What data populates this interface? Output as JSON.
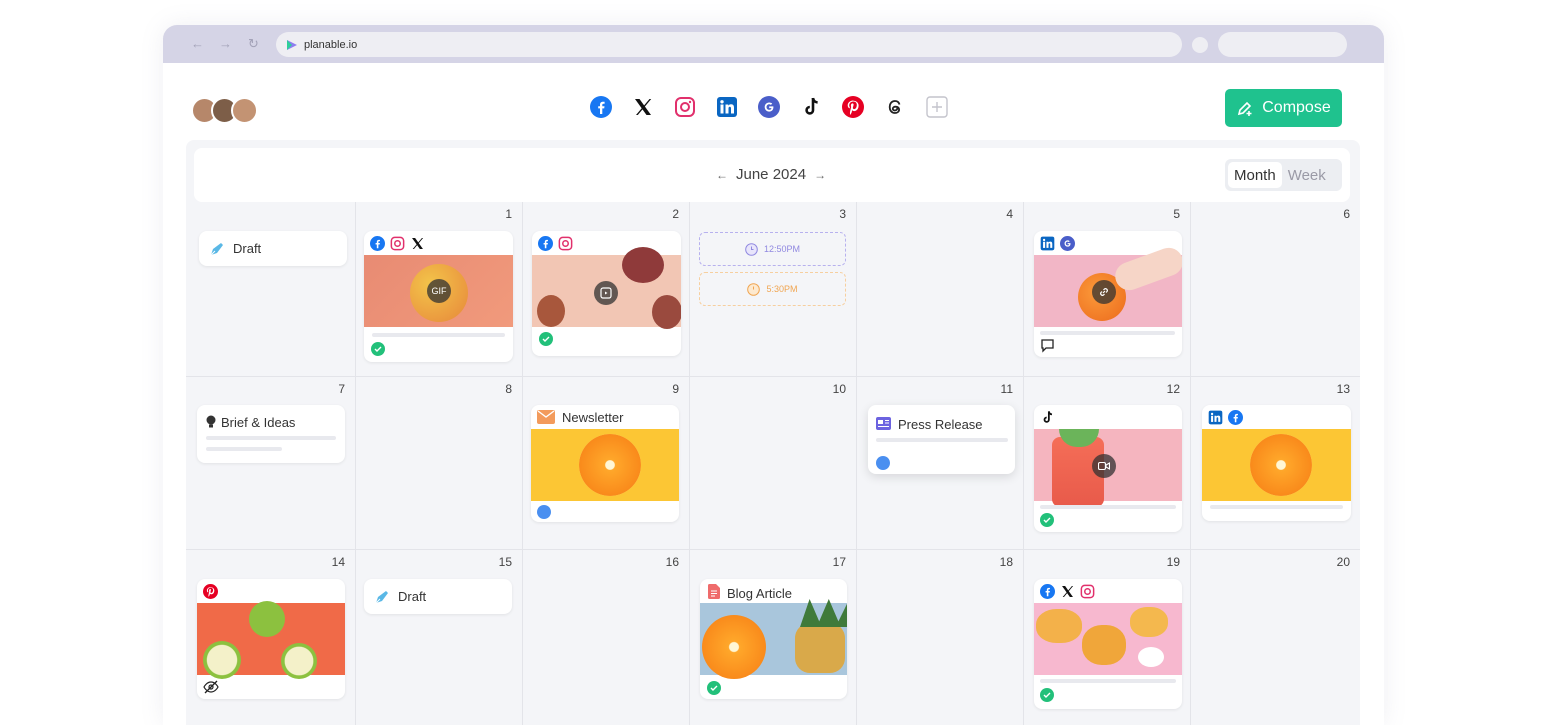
{
  "browser": {
    "url": "planable.io"
  },
  "header": {
    "compose_label": "Compose",
    "social_icons": [
      "facebook-icon",
      "x-icon",
      "instagram-icon",
      "linkedin-icon",
      "google-icon",
      "tiktok-icon",
      "pinterest-icon",
      "threads-icon",
      "add-icon"
    ]
  },
  "calendar": {
    "month_label": "June 2024",
    "view_month": "Month",
    "view_week": "Week",
    "days": [
      "1",
      "2",
      "3",
      "4",
      "5",
      "6",
      "7",
      "8",
      "9",
      "10",
      "11",
      "12",
      "13",
      "14",
      "15",
      "16",
      "17",
      "18",
      "19",
      "20"
    ],
    "cards": {
      "draft1": "Draft",
      "slot1": "12:50PM",
      "slot2": "5:30PM",
      "brief": "Brief & Ideas",
      "newsletter": "Newsletter",
      "press": "Press Release",
      "draft2": "Draft",
      "blog": "Blog Article",
      "gif": "GIF"
    }
  },
  "colors": {
    "accent": "#1fc28e",
    "chrome": "#d5d4e6",
    "check": "#22c07a",
    "clock": "#4a8ff0"
  }
}
